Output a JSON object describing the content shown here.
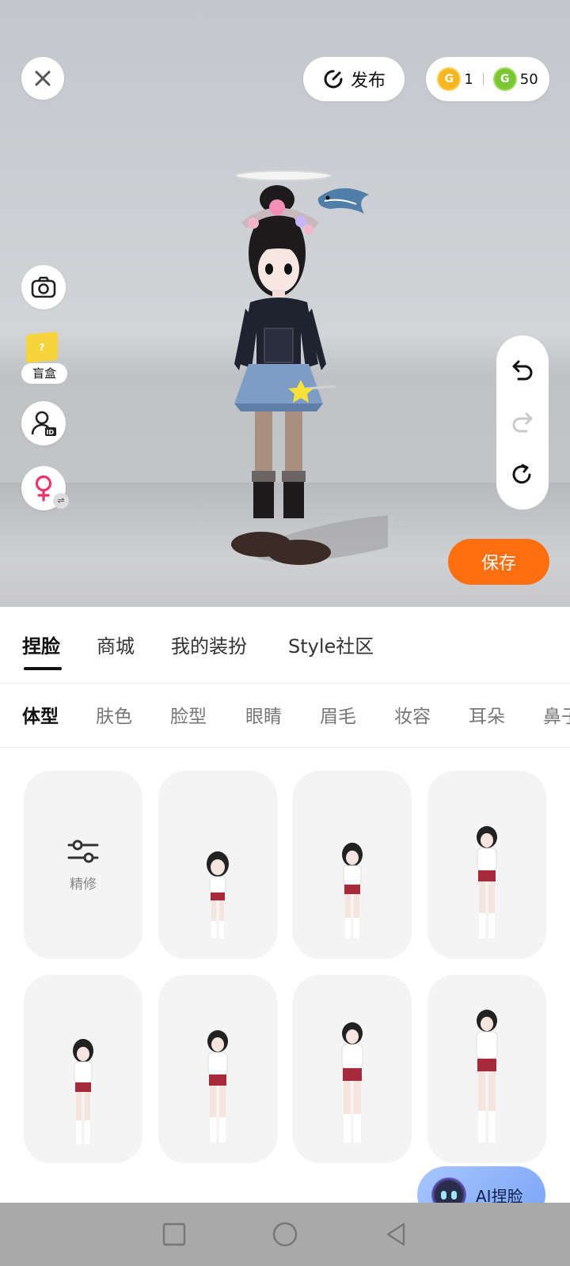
{
  "header": {
    "publish_label": "发布",
    "currency": [
      {
        "icon": "gold-coin-icon",
        "letter": "G",
        "value": "1",
        "color": "#f5b621"
      },
      {
        "icon": "green-coin-icon",
        "letter": "G",
        "value": "50",
        "color": "#7ac634"
      }
    ]
  },
  "side_tools": {
    "blindbox_label": "盲盒",
    "blindbox_mark": "?"
  },
  "save_label": "保存",
  "tabs": [
    {
      "label": "捏脸",
      "active": true
    },
    {
      "label": "商城",
      "active": false
    },
    {
      "label": "我的装扮",
      "active": false
    },
    {
      "label": "Style社区",
      "active": false
    }
  ],
  "subtabs": [
    {
      "label": "体型",
      "active": true
    },
    {
      "label": "肤色",
      "active": false
    },
    {
      "label": "脸型",
      "active": false
    },
    {
      "label": "眼睛",
      "active": false
    },
    {
      "label": "眉毛",
      "active": false
    },
    {
      "label": "妆容",
      "active": false
    },
    {
      "label": "耳朵",
      "active": false
    },
    {
      "label": "鼻子",
      "active": false
    }
  ],
  "refine_label": "精修",
  "ai_label": "AI捏脸",
  "colors": {
    "accent_orange": "#ff6f0f",
    "stage_bg": "#c9cbcf",
    "card_bg": "#f4f4f4",
    "nav_bar": "#a9a9a9"
  }
}
